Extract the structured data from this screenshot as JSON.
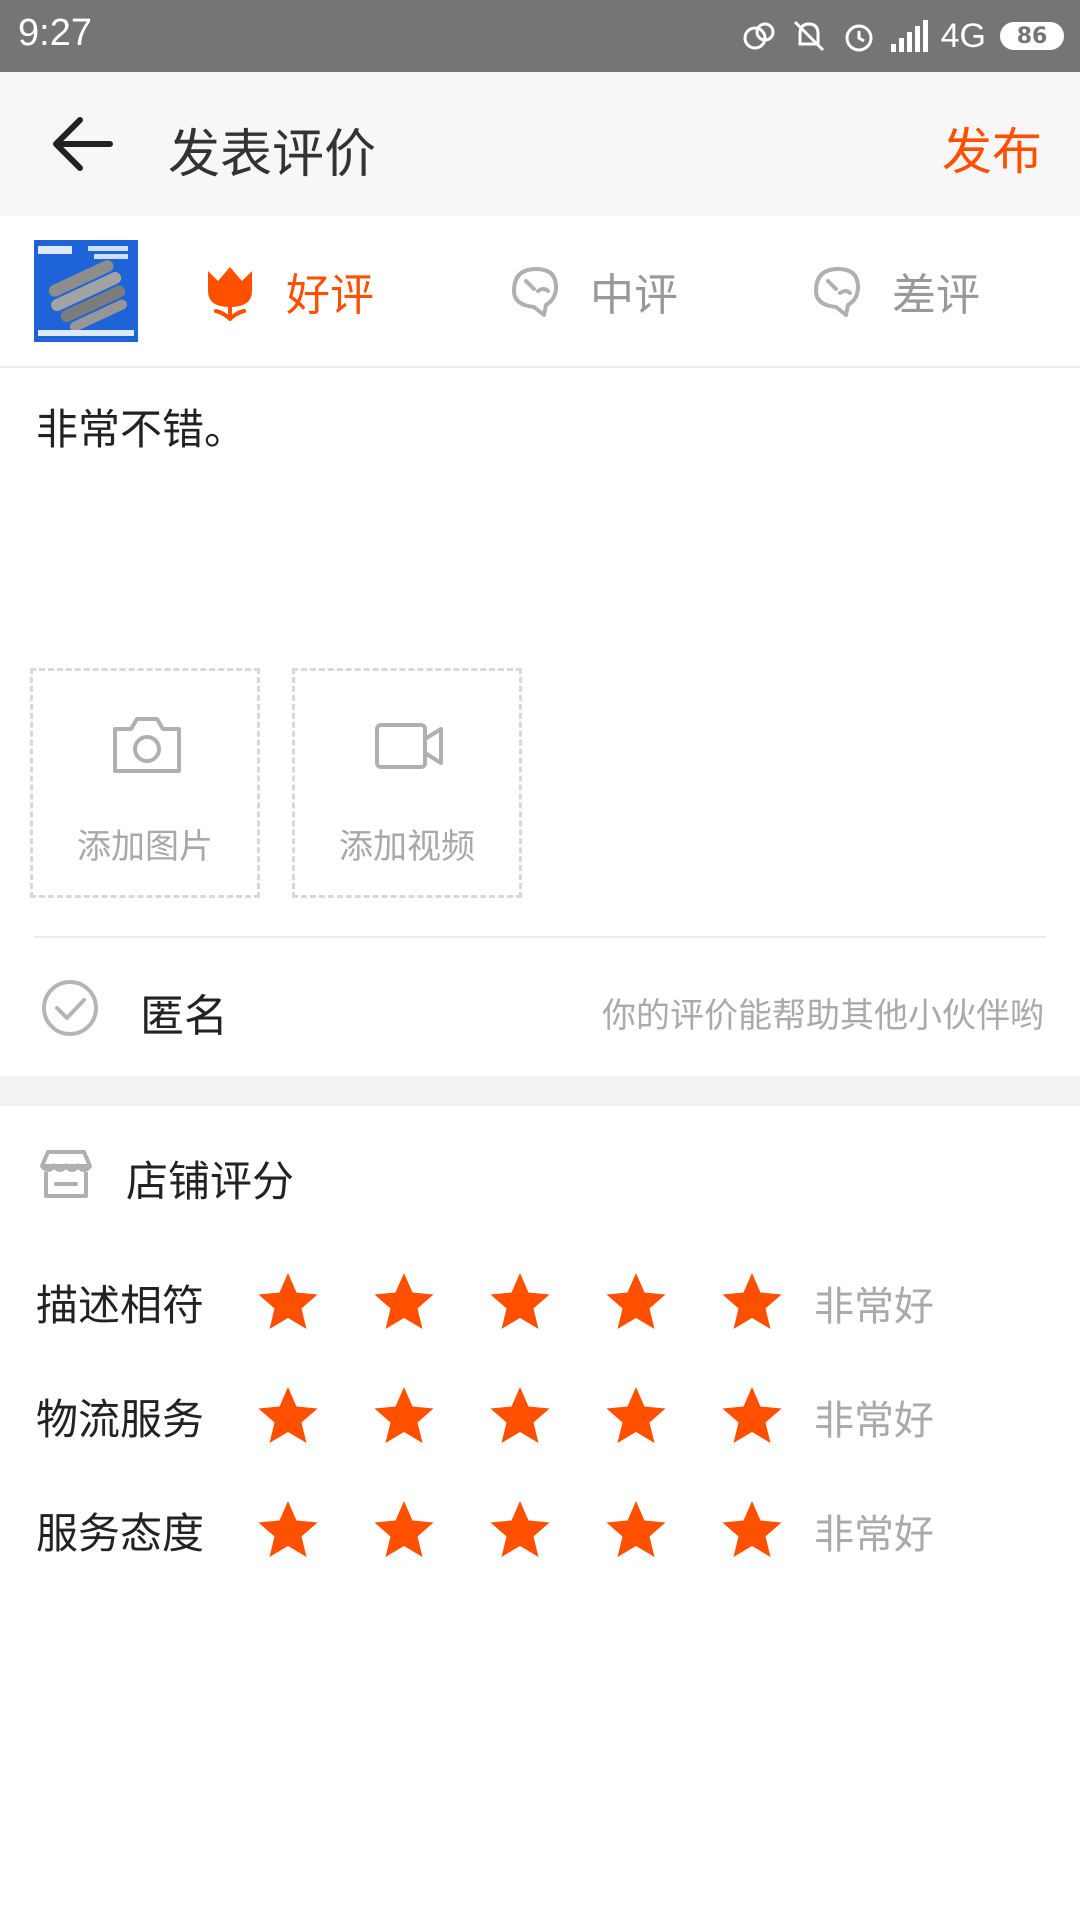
{
  "status_bar": {
    "time": "9:27",
    "network": "4G",
    "battery": "86"
  },
  "header": {
    "title": "发表评价",
    "publish": "发布"
  },
  "rating_options": [
    {
      "label": "好评",
      "selected": true
    },
    {
      "label": "中评",
      "selected": false
    },
    {
      "label": "差评",
      "selected": false
    }
  ],
  "comment": {
    "text": "非常不错。"
  },
  "uploads": {
    "photo_label": "添加图片",
    "video_label": "添加视频"
  },
  "anonymous": {
    "label": "匿名",
    "hint": "你的评价能帮助其他小伙伴哟"
  },
  "shop_rating": {
    "title": "店铺评分",
    "rows": [
      {
        "label": "描述相符",
        "stars": 5,
        "value": "非常好"
      },
      {
        "label": "物流服务",
        "stars": 5,
        "value": "非常好"
      },
      {
        "label": "服务态度",
        "stars": 5,
        "value": "非常好"
      }
    ]
  },
  "colors": {
    "accent": "#ff5000",
    "star": "#ff5000",
    "muted": "#aaaaaa"
  },
  "icons": [
    "back-arrow-icon",
    "tulip-icon",
    "sad-face-icon",
    "camera-icon",
    "video-icon",
    "check-circle-icon",
    "shop-icon",
    "star-icon"
  ]
}
